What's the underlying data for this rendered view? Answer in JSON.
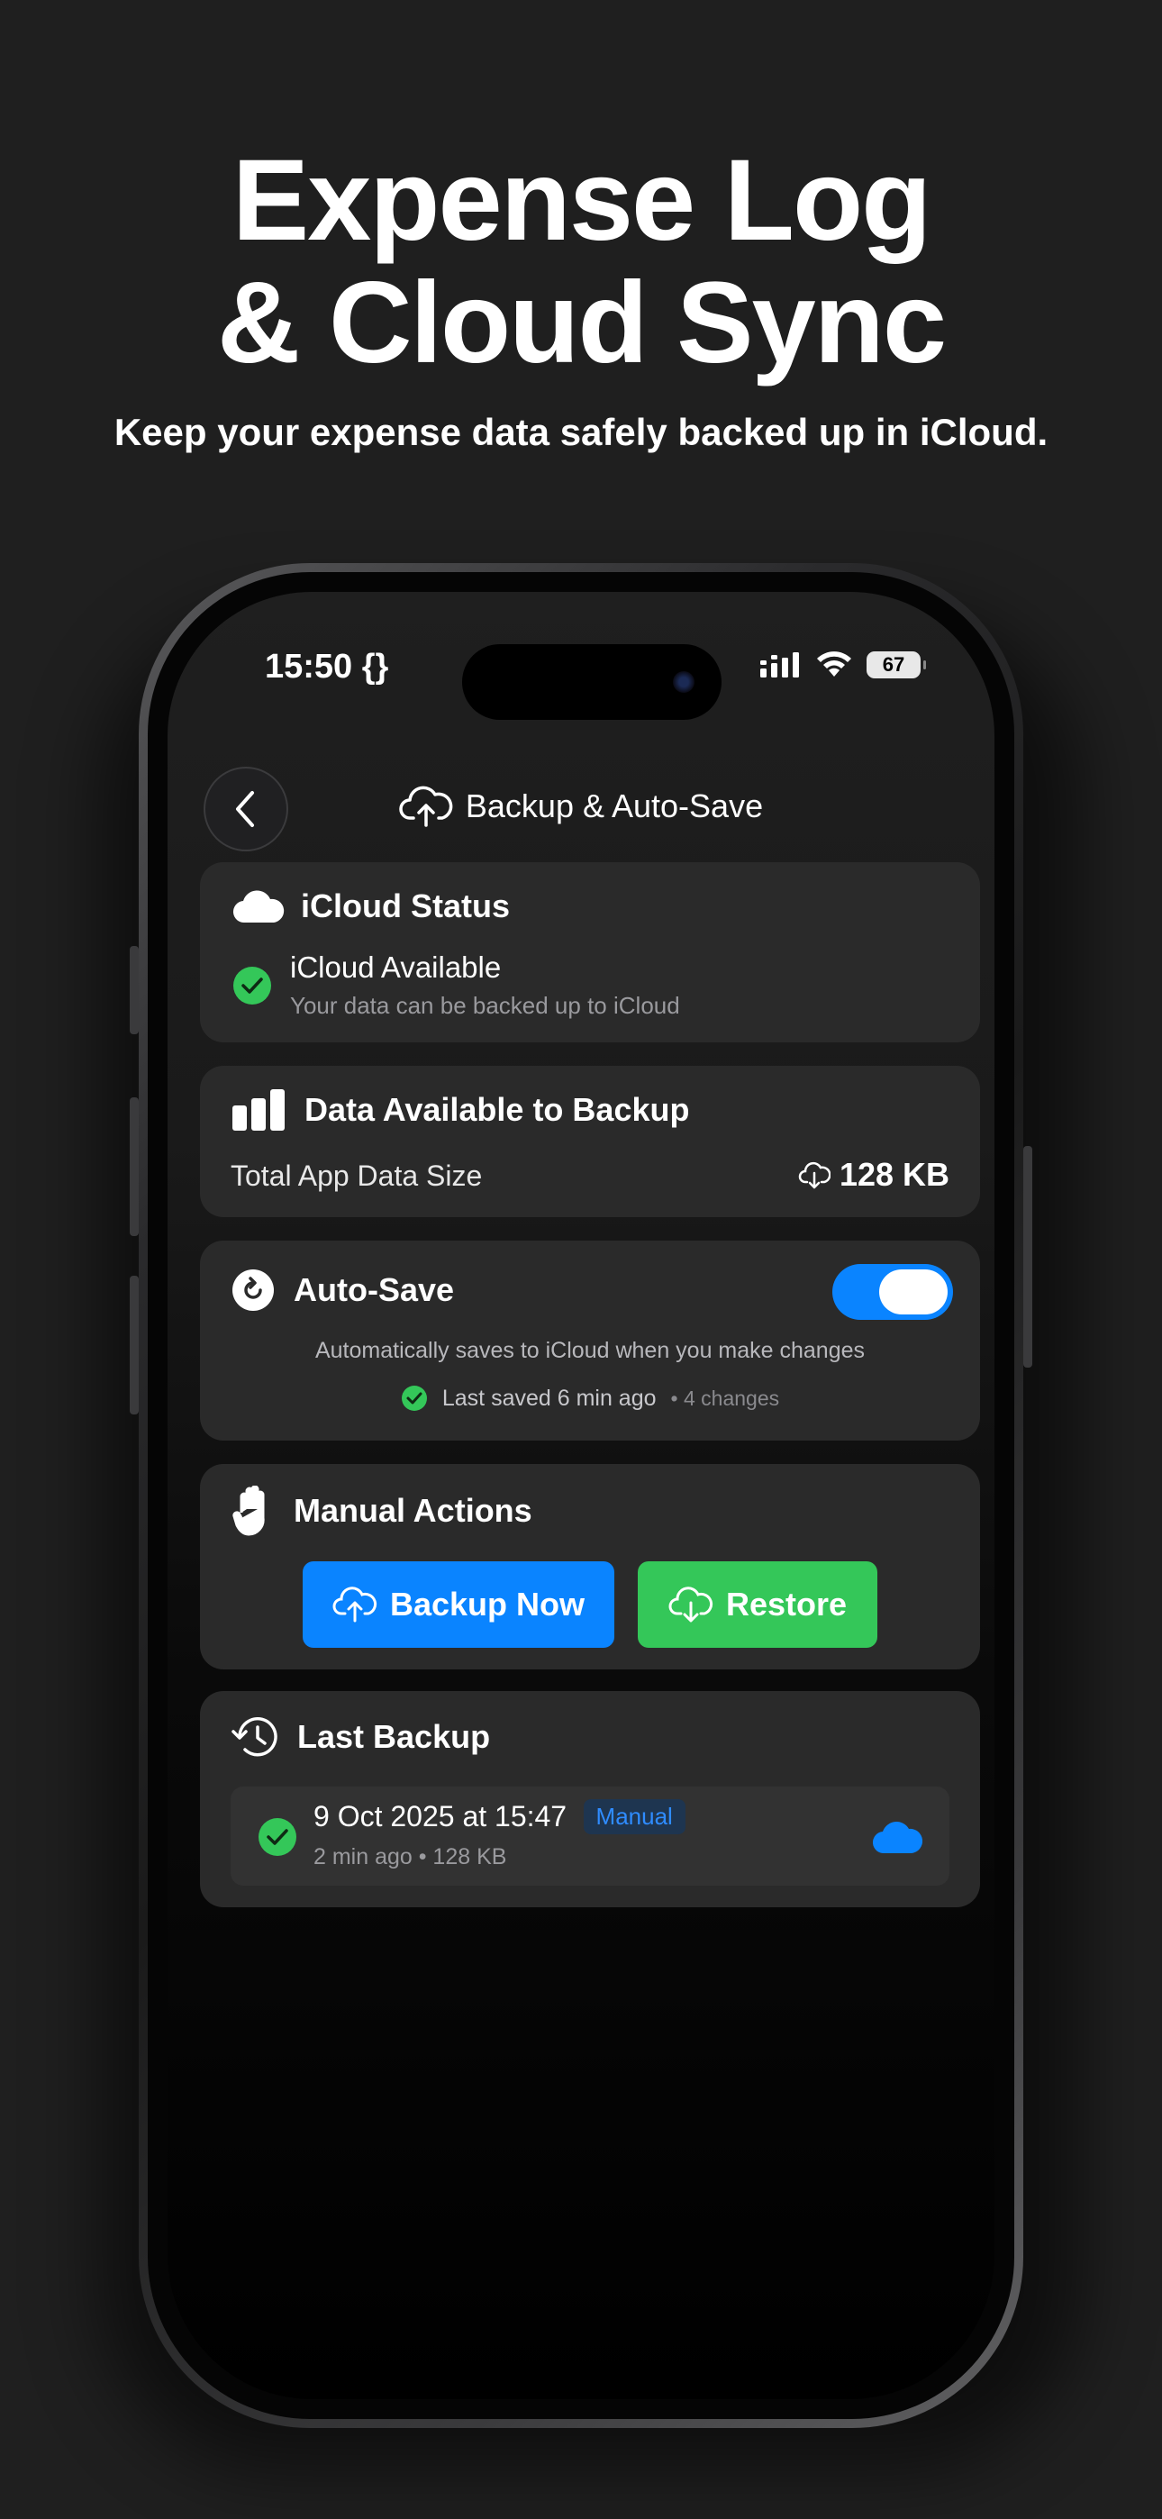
{
  "promo": {
    "headline_line1": "Expense Log",
    "headline_line2": "& Cloud Sync",
    "subline": "Keep your expense data safely backed up in iCloud."
  },
  "status_bar": {
    "time": "15:50 {}",
    "battery": "67"
  },
  "nav": {
    "title": "Backup & Auto-Save"
  },
  "icloud_status": {
    "title": "iCloud Status",
    "state": "iCloud Available",
    "description": "Your data can be backed up to iCloud"
  },
  "data_backup": {
    "title": "Data Available to Backup",
    "label": "Total App Data Size",
    "size": "128 KB"
  },
  "auto_save": {
    "title": "Auto-Save",
    "enabled": true,
    "description": "Automatically saves to iCloud when you make changes",
    "last_saved": "Last saved 6 min ago",
    "changes": "• 4 changes"
  },
  "manual_actions": {
    "title": "Manual Actions",
    "backup_label": "Backup Now",
    "restore_label": "Restore"
  },
  "last_backup": {
    "title": "Last Backup",
    "date": "9 Oct 2025 at 15:47",
    "badge": "Manual",
    "meta": "2 min ago • 128 KB"
  },
  "colors": {
    "accent_blue": "#0a84ff",
    "success_green": "#34c759",
    "card_bg": "#2a2a2a",
    "page_bg": "#1f1f1f"
  },
  "icons": [
    "chevron-left-icon",
    "cloud-upload-icon",
    "cloud-icon",
    "checkmark-circle-icon",
    "bar-chart-icon",
    "cloud-download-icon",
    "refresh-icon",
    "hand-icon",
    "history-icon"
  ]
}
